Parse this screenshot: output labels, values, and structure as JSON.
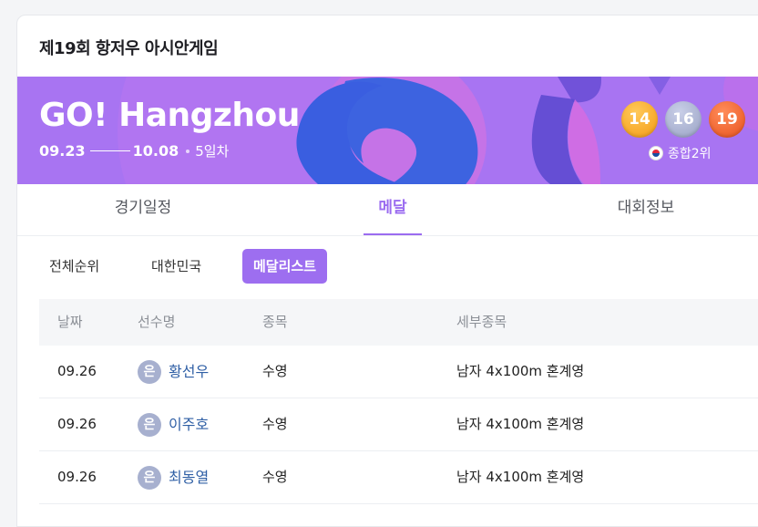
{
  "card": {
    "title": "제19회 항저우 아시안게임"
  },
  "banner": {
    "logo": "GO! Hangzhou",
    "start_date": "09.23",
    "end_date": "10.08",
    "day": "5일차",
    "medals": {
      "gold": "14",
      "silver": "16",
      "bronze": "19"
    },
    "rank": "종합2위",
    "rank_flag_icon": "korea-flag-icon",
    "colors": {
      "background": "#b06ff0",
      "gold": "#f6a41a",
      "silver": "#a2abcb",
      "bronze": "#ee5a24"
    }
  },
  "tabs": [
    {
      "label": "경기일정",
      "active": false
    },
    {
      "label": "메달",
      "active": true
    },
    {
      "label": "대회정보",
      "active": false
    }
  ],
  "subtabs": [
    {
      "label": "전체순위",
      "active": false
    },
    {
      "label": "대한민국",
      "active": false
    },
    {
      "label": "메달리스트",
      "active": true
    }
  ],
  "table": {
    "headers": [
      "날짜",
      "선수명",
      "종목",
      "세부종목"
    ],
    "rows": [
      {
        "date": "09.26",
        "medal": "은",
        "athlete": "황선우",
        "sport": "수영",
        "event": "남자 4x100m 혼계영"
      },
      {
        "date": "09.26",
        "medal": "은",
        "athlete": "이주호",
        "sport": "수영",
        "event": "남자 4x100m 혼계영"
      },
      {
        "date": "09.26",
        "medal": "은",
        "athlete": "최동열",
        "sport": "수영",
        "event": "남자 4x100m 혼계영"
      }
    ]
  },
  "accent_color": "#9b6cf0"
}
